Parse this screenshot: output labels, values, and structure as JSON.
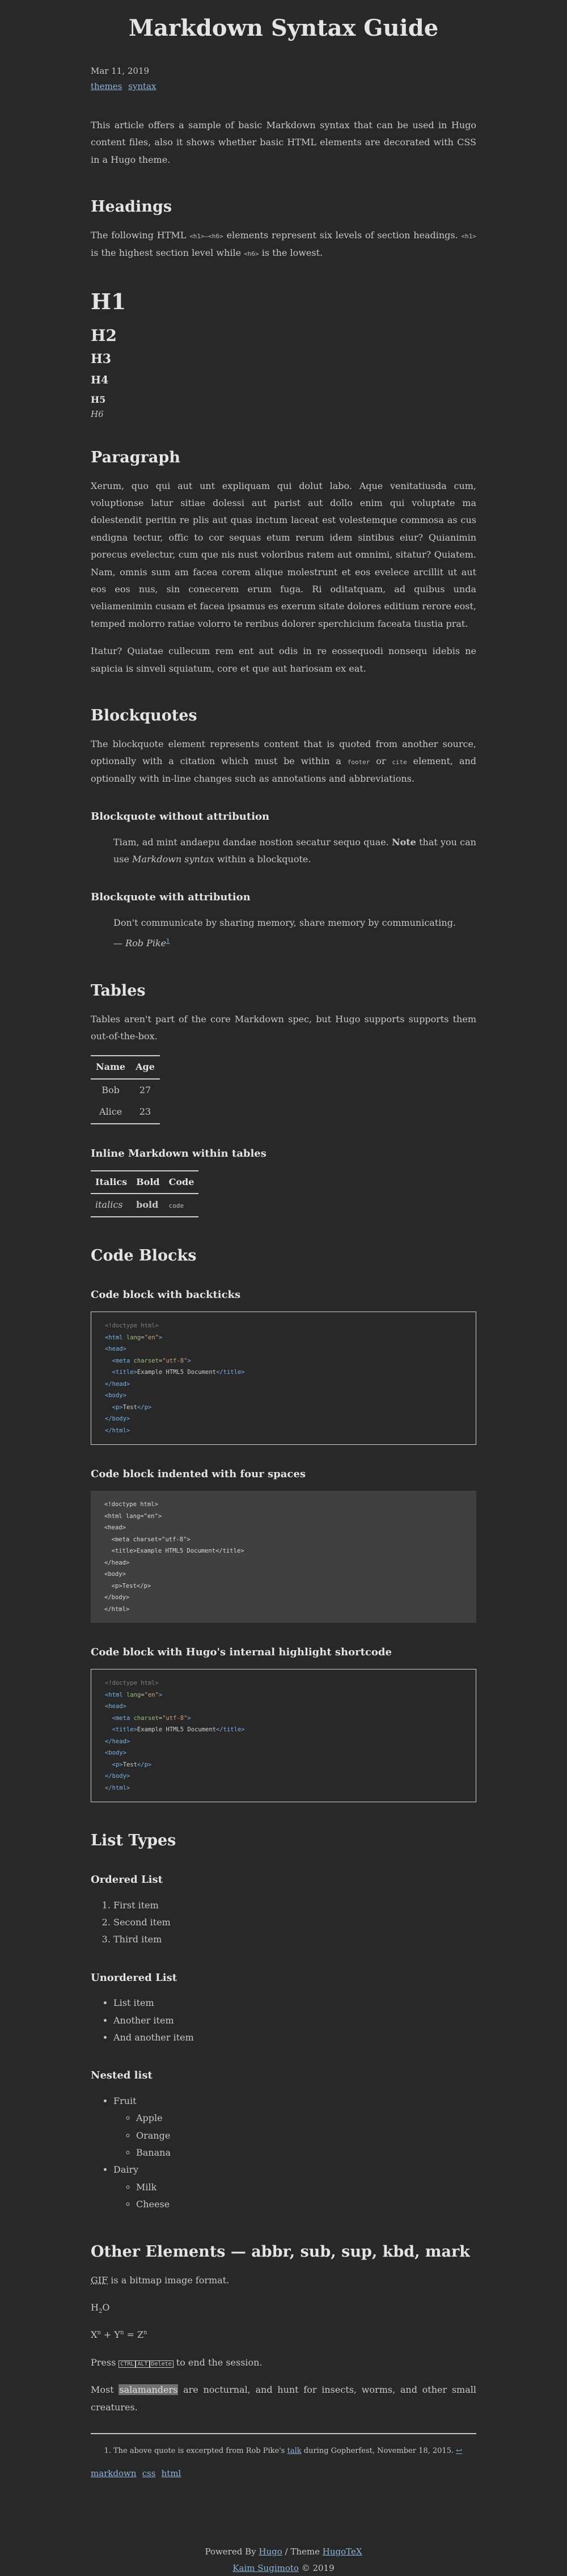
{
  "site_title": "Markdown Syntax Guide",
  "meta": {
    "date": "Mar 11, 2019",
    "tags": [
      "themes",
      "syntax"
    ]
  },
  "intro": "This article offers a sample of basic Markdown syntax that can be used in Hugo content files, also it shows whether basic HTML elements are decorated with CSS in a Hugo theme.",
  "headings": {
    "title": "Headings",
    "text_a": "The following HTML ",
    "code_a": "<h1>—<h6>",
    "text_b": " elements represent six levels of section headings. ",
    "code_b": "<h1>",
    "text_c": " is the highest section level while ",
    "code_c": "<h6>",
    "text_d": " is the lowest.",
    "demo": [
      "H1",
      "H2",
      "H3",
      "H4",
      "H5",
      "H6"
    ]
  },
  "paragraph": {
    "title": "Paragraph",
    "p1": "Xerum, quo qui aut unt expliquam qui dolut labo. Aque venitatiusda cum, voluptionse latur sitiae dolessi aut parist aut dollo enim qui voluptate ma dolestendit peritin re plis aut quas inctum laceat est volestemque commosa as cus endigna tectur, offic to cor sequas etum rerum idem sintibus eiur? Quianimin porecus evelectur, cum que nis nust voloribus ratem aut omnimi, sitatur? Quiatem. Nam, omnis sum am facea corem alique molestrunt et eos evelece arcillit ut aut eos eos nus, sin conecerem erum fuga. Ri oditatquam, ad quibus unda veliamenimin cusam et facea ipsamus es exerum sitate dolores editium rerore eost, temped molorro ratiae volorro te reribus dolorer sperchicium faceata tiustia prat.",
    "p2": "Itatur? Quiatae cullecum rem ent aut odis in re eossequodi nonsequ idebis ne sapicia is sinveli squiatum, core et que aut hariosam ex eat."
  },
  "blockquotes": {
    "title": "Blockquotes",
    "text_a": "The blockquote element represents content that is quoted from another source, optionally with a citation which must be within a ",
    "code_a": "footer",
    "text_b": " or ",
    "code_b": "cite",
    "text_c": " element, and optionally with in-line changes such as annotations and abbreviations.",
    "without_title": "Blockquote without attribution",
    "q1_a": "Tiam, ad mint andaepu dandae nostion secatur sequo quae. ",
    "q1_bold": "Note",
    "q1_b": " that you can use ",
    "q1_em": "Markdown syntax",
    "q1_c": " within a blockquote.",
    "with_title": "Blockquote with attribution",
    "q2": "Don't communicate by sharing memory, share memory by communicating.",
    "q2_dash": "— ",
    "q2_cite": "Rob Pike",
    "q2_fn": "1"
  },
  "tables": {
    "title": "Tables",
    "text": "Tables aren't part of the core Markdown spec, but Hugo supports supports them out-of-the-box.",
    "t1_headers": [
      "Name",
      "Age"
    ],
    "t1_rows": [
      [
        "Bob",
        "27"
      ],
      [
        "Alice",
        "23"
      ]
    ],
    "inline_title": "Inline Markdown within tables",
    "t2_headers": [
      "Italics",
      "Bold",
      "Code"
    ],
    "t2_row": [
      "italics",
      "bold",
      "code"
    ]
  },
  "code": {
    "title": "Code Blocks",
    "backticks_title": "Code block with backticks",
    "indented_title": "Code block indented with four spaces",
    "shortcode_title": "Code block with Hugo's internal highlight shortcode",
    "plain_lines": [
      "<!doctype html>",
      "<html lang=\"en\">",
      "<head>",
      "  <meta charset=\"utf-8\">",
      "  <title>Example HTML5 Document</title>",
      "</head>",
      "<body>",
      "  <p>Test</p>",
      "</body>",
      "</html>"
    ]
  },
  "lists": {
    "title": "List Types",
    "ordered_title": "Ordered List",
    "ordered": [
      "First item",
      "Second item",
      "Third item"
    ],
    "unordered_title": "Unordered List",
    "unordered": [
      "List item",
      "Another item",
      "And another item"
    ],
    "nested_title": "Nested list",
    "nested": [
      {
        "label": "Fruit",
        "children": [
          "Apple",
          "Orange",
          "Banana"
        ]
      },
      {
        "label": "Dairy",
        "children": [
          "Milk",
          "Cheese"
        ]
      }
    ]
  },
  "other": {
    "title": "Other Elements — abbr, sub, sup, kbd, mark",
    "abbr": "GIF",
    "abbr_rest": " is a bitmap image format.",
    "h2o_h": "H",
    "h2o_sub": "2",
    "h2o_o": "O",
    "fermat": [
      "X",
      "n",
      " + Y",
      "n",
      " = Z",
      "n"
    ],
    "press": "Press ",
    "keys": [
      "CTRL",
      "ALT",
      "Delete"
    ],
    "press_rest": " to end the session.",
    "mark_a": "Most ",
    "mark_word": "salamanders",
    "mark_b": " are nocturnal, and hunt for insects, worms, and other small creatures."
  },
  "footnote": {
    "text_a": "The above quote is excerpted from Rob Pike's ",
    "link": "talk",
    "text_b": " during Gopherfest, November 18, 2015. ",
    "back": "↩"
  },
  "post_tags": [
    "markdown",
    "css",
    "html"
  ],
  "footer": {
    "powered": "Powered By ",
    "hugo": "Hugo",
    "theme": " / Theme ",
    "theme_name": "HugoTeX",
    "author": "Kaim Sugimoto",
    "year": " © 2019"
  }
}
